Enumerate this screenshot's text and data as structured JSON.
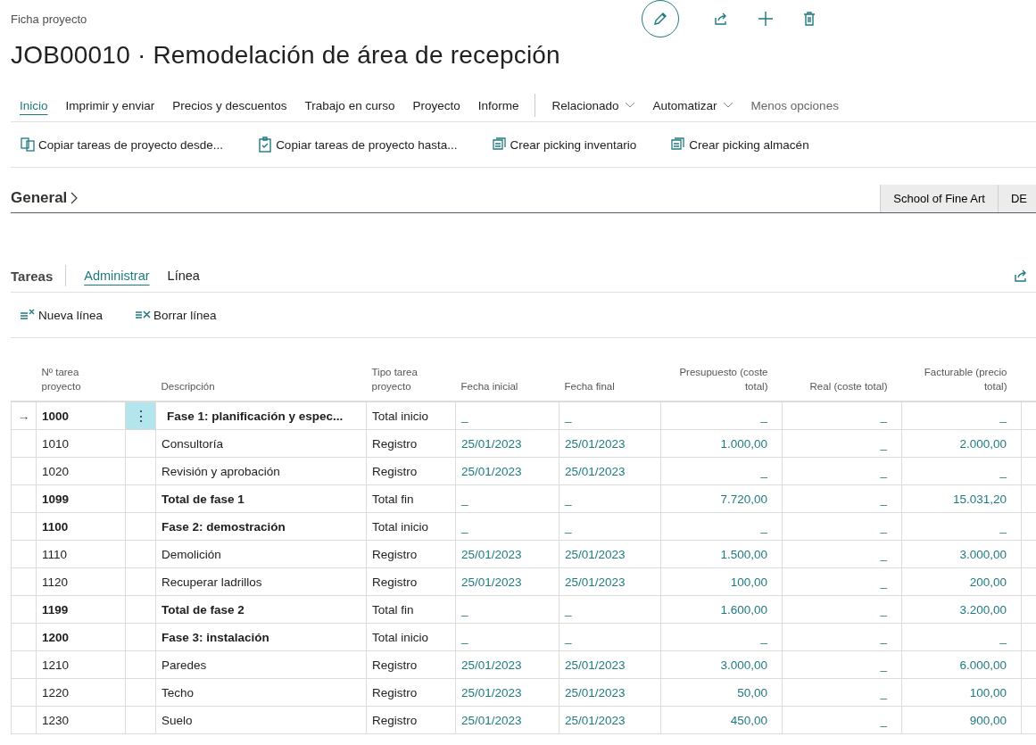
{
  "page": {
    "caption": "Ficha proyecto",
    "title": "JOB00010 · Remodelación de área de recepción"
  },
  "header_actions": [
    {
      "kind": "edit"
    },
    {
      "kind": "share"
    },
    {
      "kind": "new"
    },
    {
      "kind": "delete"
    }
  ],
  "action_tabs": [
    {
      "label": "Inicio",
      "kind": "tab",
      "selected": true
    },
    {
      "label": "Imprimir y enviar",
      "kind": "tab",
      "selected": false
    },
    {
      "label": "Precios y descuentos",
      "kind": "tab",
      "selected": false
    },
    {
      "label": "Trabajo en curso",
      "kind": "tab",
      "selected": false
    },
    {
      "label": "Proyecto",
      "kind": "tab",
      "selected": false
    },
    {
      "label": "Informe",
      "kind": "tab",
      "selected": false
    },
    {
      "label": "Relacionado",
      "kind": "menu",
      "selected": false
    },
    {
      "label": "Automatizar",
      "kind": "menu",
      "selected": false
    },
    {
      "label": "Menos opciones",
      "kind": "toggle",
      "selected": false
    }
  ],
  "actions": [
    {
      "label": "Copiar tareas de proyecto desde...",
      "kind": "copy-from"
    },
    {
      "label": "Copiar tareas de proyecto hasta...",
      "kind": "copy-to"
    },
    {
      "label": "Crear picking inventario",
      "kind": "inventory-pick"
    },
    {
      "label": "Crear picking almacén",
      "kind": "warehouse-pick"
    }
  ],
  "general": {
    "title": "General",
    "expanded": false
  },
  "factbox_tabs": [
    "School of Fine Art",
    "DE"
  ],
  "tasks": {
    "title": "Tareas",
    "current_row_marker": "→",
    "row_menu": "⋮",
    "tabs": [
      {
        "label": "Administrar",
        "selected": true
      },
      {
        "label": "Línea",
        "selected": false
      }
    ],
    "actions": [
      {
        "label": "Nueva línea",
        "kind": "new-line"
      },
      {
        "label": "Borrar línea",
        "kind": "delete-line"
      }
    ],
    "columns": [
      "Nº tarea proyecto",
      "Descripción",
      "Tipo tarea proyecto",
      "Fecha inicial",
      "Fecha final",
      "Presupuesto (coste total)",
      "Real (coste total)",
      "Facturable (precio total)"
    ],
    "rows": [
      {
        "no": "1000",
        "description": "Fase 1: planificación y espec...",
        "type": "Total inicio",
        "start": "_",
        "end": "_",
        "budget": "_",
        "actual": "_",
        "billable": "_",
        "kind": "heading",
        "selected": true
      },
      {
        "no": "1010",
        "description": "Consultoría",
        "type": "Registro",
        "start": "25/01/2023",
        "end": "25/01/2023",
        "budget": "1.000,00",
        "actual": "_",
        "billable": "2.000,00",
        "kind": "posting",
        "selected": false
      },
      {
        "no": "1020",
        "description": "Revisión y aprobación",
        "type": "Registro",
        "start": "25/01/2023",
        "end": "25/01/2023",
        "budget": "_",
        "actual": "_",
        "billable": "_",
        "kind": "posting",
        "selected": false
      },
      {
        "no": "1099",
        "description": "Total de fase 1",
        "type": "Total fin",
        "start": "_",
        "end": "_",
        "budget": "7.720,00",
        "actual": "_",
        "billable": "15.031,20",
        "kind": "total",
        "selected": false
      },
      {
        "no": "1100",
        "description": "Fase 2: demostración",
        "type": "Total inicio",
        "start": "_",
        "end": "_",
        "budget": "_",
        "actual": "_",
        "billable": "_",
        "kind": "heading",
        "selected": false
      },
      {
        "no": "1110",
        "description": "Demolición",
        "type": "Registro",
        "start": "25/01/2023",
        "end": "25/01/2023",
        "budget": "1.500,00",
        "actual": "_",
        "billable": "3.000,00",
        "kind": "posting",
        "selected": false
      },
      {
        "no": "1120",
        "description": "Recuperar ladrillos",
        "type": "Registro",
        "start": "25/01/2023",
        "end": "25/01/2023",
        "budget": "100,00",
        "actual": "_",
        "billable": "200,00",
        "kind": "posting",
        "selected": false
      },
      {
        "no": "1199",
        "description": "Total de fase 2",
        "type": "Total fin",
        "start": "_",
        "end": "_",
        "budget": "1.600,00",
        "actual": "_",
        "billable": "3.200,00",
        "kind": "total",
        "selected": false
      },
      {
        "no": "1200",
        "description": "Fase 3: instalación",
        "type": "Total inicio",
        "start": "_",
        "end": "_",
        "budget": "_",
        "actual": "_",
        "billable": "_",
        "kind": "heading",
        "selected": false
      },
      {
        "no": "1210",
        "description": "Paredes",
        "type": "Registro",
        "start": "25/01/2023",
        "end": "25/01/2023",
        "budget": "3.000,00",
        "actual": "_",
        "billable": "6.000,00",
        "kind": "posting",
        "selected": false
      },
      {
        "no": "1220",
        "description": "Techo",
        "type": "Registro",
        "start": "25/01/2023",
        "end": "25/01/2023",
        "budget": "50,00",
        "actual": "_",
        "billable": "100,00",
        "kind": "posting",
        "selected": false
      },
      {
        "no": "1230",
        "description": "Suelo",
        "type": "Registro",
        "start": "25/01/2023",
        "end": "25/01/2023",
        "budget": "450,00",
        "actual": "_",
        "billable": "900,00",
        "kind": "posting",
        "selected": false
      }
    ]
  }
}
